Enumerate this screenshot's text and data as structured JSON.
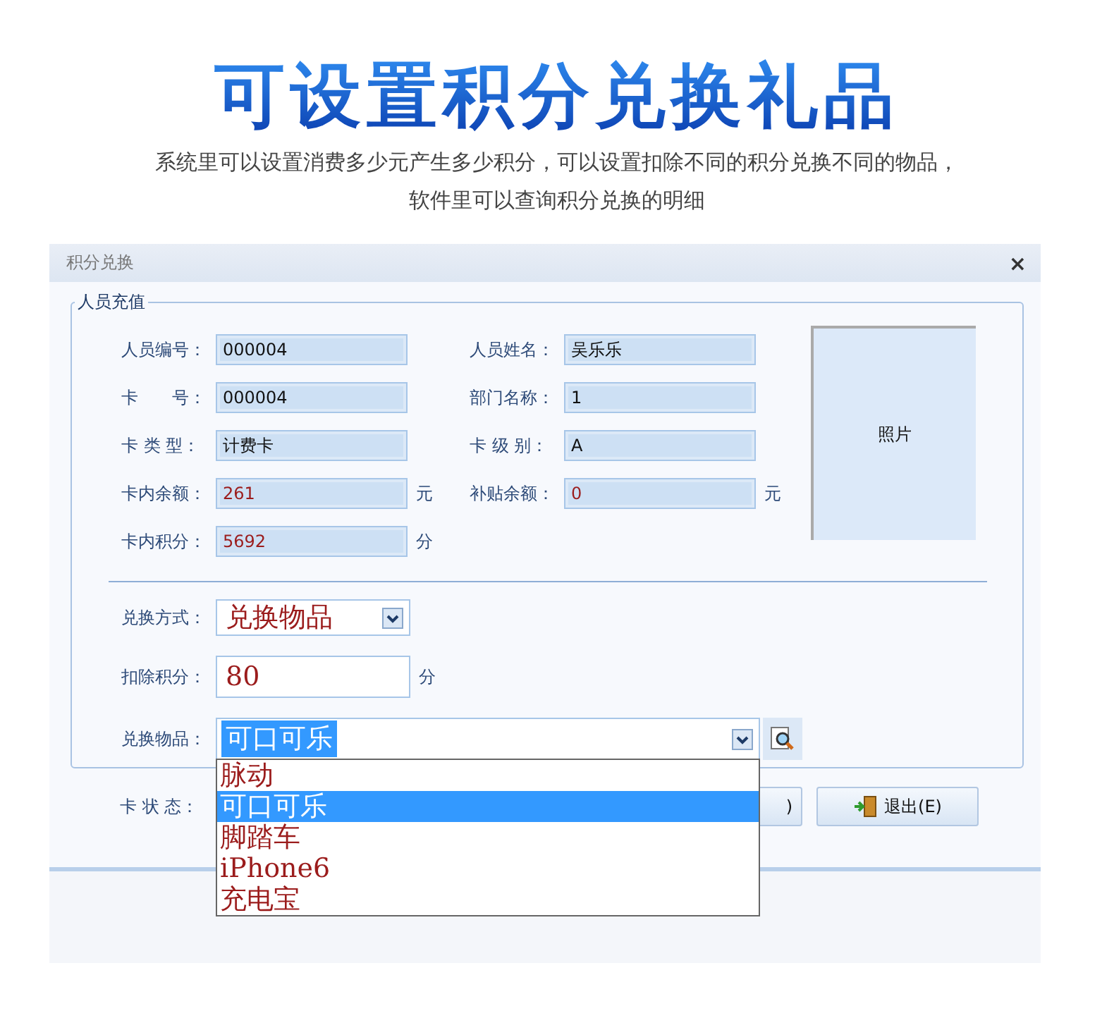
{
  "headline": "可设置积分兑换礼品",
  "subtitle": [
    "系统里可以设置消费多少元产生多少积分，可以设置扣除不同的积分兑换不同的物品，",
    "软件里可以查询积分兑换的明细"
  ],
  "dialog": {
    "title": "积分兑换",
    "close": "×",
    "group": {
      "legend": "人员充值",
      "left": [
        {
          "label": "人员编号：",
          "value": "000004",
          "kind": "text"
        },
        {
          "label": "卡　　号：",
          "value": "000004",
          "kind": "text"
        },
        {
          "label": "卡 类 型：",
          "value": "计费卡",
          "kind": "text"
        },
        {
          "label": "卡内余额：",
          "value": "261",
          "kind": "amount",
          "unit": "元"
        },
        {
          "label": "卡内积分：",
          "value": "5692",
          "kind": "amount",
          "unit": "分"
        }
      ],
      "right": [
        {
          "label": "人员姓名：",
          "value": "吴乐乐",
          "kind": "text"
        },
        {
          "label": "部门名称：",
          "value": "1",
          "kind": "text"
        },
        {
          "label": "卡 级 别：",
          "value": "A",
          "kind": "text"
        },
        {
          "label": "补贴余额：",
          "value": "0",
          "kind": "amount",
          "unit": "元"
        }
      ],
      "photo": "照片",
      "method": {
        "label": "兑换方式：",
        "value": "兑换物品"
      },
      "deduct": {
        "label": "扣除积分：",
        "value": "80",
        "unit": "分"
      },
      "item": {
        "label": "兑换物品：",
        "value": "可口可乐",
        "expanded": true,
        "options": [
          {
            "label": "脉动",
            "selected": false
          },
          {
            "label": "可口可乐",
            "selected": true
          },
          {
            "label": "脚踏车",
            "selected": false
          },
          {
            "label": "iPhone6",
            "selected": false
          },
          {
            "label": "充电宝",
            "selected": false
          }
        ]
      }
    },
    "status_label": "卡 状 态：",
    "buttons": [
      {
        "label": ")",
        "kind": "partial"
      },
      {
        "label": "退出(E)",
        "kind": "exit"
      }
    ]
  }
}
